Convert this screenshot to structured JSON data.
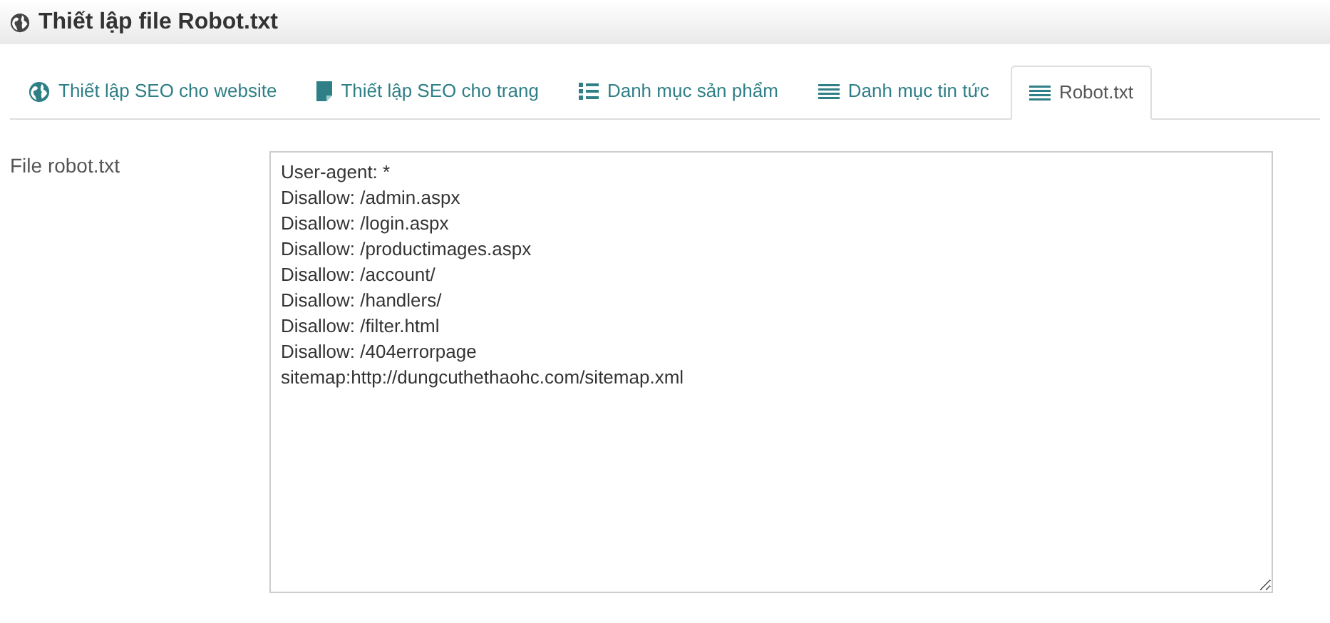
{
  "header": {
    "title": "Thiết lập file Robot.txt"
  },
  "tabs": [
    {
      "label": "Thiết lập SEO cho website",
      "kind": "globe",
      "selected": false
    },
    {
      "label": "Thiết lập SEO cho trang",
      "kind": "page",
      "selected": false
    },
    {
      "label": "Danh mục sản phẩm",
      "kind": "bullets",
      "selected": false
    },
    {
      "label": "Danh mục tin tức",
      "kind": "lines",
      "selected": false
    },
    {
      "label": "Robot.txt",
      "kind": "lines",
      "selected": true
    }
  ],
  "form": {
    "label": "File robot.txt",
    "lines": [
      "User-agent: *",
      "Disallow: /admin.aspx",
      "Disallow: /login.aspx",
      "Disallow: /productimages.aspx",
      "Disallow: /account/",
      "Disallow: /handlers/",
      "Disallow: /filter.html",
      "Disallow: /404errorpage",
      "sitemap:http://dungcuthethaohc.com/sitemap.xml"
    ]
  }
}
